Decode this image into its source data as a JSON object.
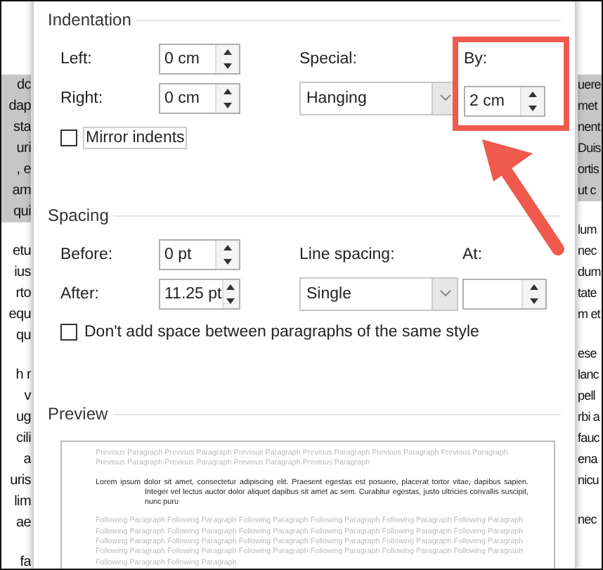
{
  "background_document": {
    "left_paragraphs": [
      {
        "highlighted": true,
        "lines": [
          "dc",
          "dap",
          "sta",
          "uri",
          ", e",
          "am",
          "qui"
        ]
      },
      {
        "highlighted": false,
        "lines": [
          "etu",
          "ius",
          "rto",
          "equ",
          "qu"
        ]
      },
      {
        "highlighted": false,
        "lines": [
          "h r",
          "v",
          "ug",
          "cili",
          "a",
          "uris",
          "lim",
          "ae"
        ]
      },
      {
        "highlighted": false,
        "lines": [
          "fa"
        ]
      }
    ],
    "right_paragraphs": [
      {
        "highlighted": true,
        "lines": [
          "uere",
          "met",
          "nent",
          "Duis",
          "ortis",
          "ut c"
        ]
      },
      {
        "highlighted": false,
        "lines": [
          "lum",
          "nec",
          "dum",
          "tate",
          "m et"
        ]
      },
      {
        "highlighted": false,
        "lines": [
          "ese",
          "lanc",
          "pell",
          "rbi a",
          "fauc",
          "ena",
          "nicu"
        ]
      },
      {
        "highlighted": false,
        "lines": [
          "nec"
        ]
      }
    ]
  },
  "indentation": {
    "title": "Indentation",
    "left": {
      "label": "Left:",
      "value": "0 cm"
    },
    "right": {
      "label": "Right:",
      "value": "0 cm"
    },
    "special": {
      "label": "Special:",
      "value": "Hanging"
    },
    "by": {
      "label": "By:",
      "value": "2 cm",
      "highlighted": true
    },
    "mirror_indents": {
      "label": "Mirror indents",
      "checked": false
    }
  },
  "spacing": {
    "title": "Spacing",
    "before": {
      "label": "Before:",
      "value": "0 pt"
    },
    "after": {
      "label": "After:",
      "value": "11.25 pt"
    },
    "line_spacing": {
      "label": "Line spacing:",
      "value": "Single"
    },
    "at": {
      "label": "At:"
    },
    "dont_add_space": {
      "label": "Don't add space between paragraphs of the same style",
      "checked": false
    }
  },
  "preview": {
    "title": "Preview",
    "previous_text": "Previous Paragraph Previous Paragraph Previous Paragraph Previous Paragraph Previous Paragraph Previous Paragraph Previous Paragraph Previous Paragraph Previous Paragraph Previous Paragraph",
    "paragraph_text": "Lorem ipsum dolor sit amet, consectetur adipiscing elit. Praesent egestas est posuere, placerat tortor vitae, dapibus sapien. Integer vel lectus auctor dolor aliquet dapibus sit amet ac sem. Curabitur egestas, justo ultricies convallis suscipit, nunc puru",
    "following_text": "Following Paragraph Following Paragraph Following Paragraph Following Paragraph Following Paragraph Following Paragraph Following Paragraph Following Paragraph Following Paragraph Following Paragraph Following Paragraph Following Paragraph Following Paragraph Following Paragraph Following Paragraph Following Paragraph Following Paragraph Following Paragraph Following Paragraph Following Paragraph Following Paragraph Following Paragraph Following Paragraph Following Paragraph Following Paragraph Following Paragraph"
  }
}
